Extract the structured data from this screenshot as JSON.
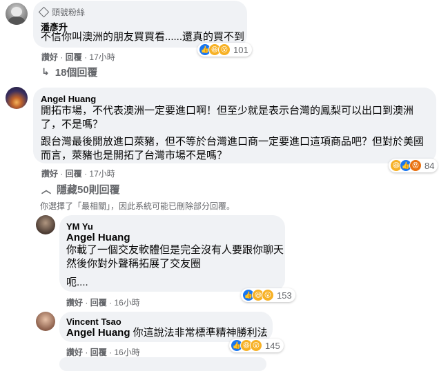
{
  "comment1": {
    "badge_icon": "diamond-icon",
    "badge_label": "頭號粉絲",
    "author": "潘彥升",
    "text": "不信你叫澳洲的朋友買買看......還真的買不到",
    "like_label": "讚好",
    "reply_label": "回覆",
    "time": "17小時",
    "reaction_count": "101",
    "reactions": [
      "like",
      "haha",
      "wow"
    ]
  },
  "toggle1": {
    "icon": "reply-arrow-icon",
    "label": "18個回覆"
  },
  "comment2": {
    "author": "Angel Huang",
    "text_p1_l1": "開拓市場，不代表澳洲一定要進口啊！但至少就是表示台灣的鳳梨可以出口到澳洲",
    "text_p1_l2": "了，不是嗎？",
    "text_p2_l1": "跟台灣最後開放進口萊豬，但不等於台灣進口商一定要進口這項商品吧？但對於美國",
    "text_p2_l2": "而言，萊豬也是開拓了台灣市場不是嗎？",
    "like_label": "讚好",
    "reply_label": "回覆",
    "time": "17小時",
    "reaction_count": "84",
    "reactions": [
      "haha",
      "like",
      "angry"
    ]
  },
  "toggle2": {
    "icon": "chevron-up-icon",
    "label": "隱藏50則回覆"
  },
  "notice": "你選擇了「最相關」，因此系統可能已刪除部分回覆。",
  "reply1": {
    "author": "YM Yu",
    "mention": "Angel Huang",
    "line1": "你載了一個交友軟體但是完全沒有人要跟你聊天",
    "line2": "然後你對外聲稱拓展了交友圈",
    "line3": "呃....",
    "like_label": "讚好",
    "reply_label": "回覆",
    "time": "16小時",
    "reaction_count": "153",
    "reactions": [
      "like",
      "haha",
      "wow"
    ]
  },
  "reply2": {
    "author": "Vincent Tsao",
    "mention": "Angel Huang",
    "text": "你這說法非常標準精神勝利法",
    "like_label": "讚好",
    "reply_label": "回覆",
    "time": "16小時",
    "reaction_count": "145",
    "reactions": [
      "like",
      "haha",
      "wow"
    ]
  },
  "separator": "·"
}
